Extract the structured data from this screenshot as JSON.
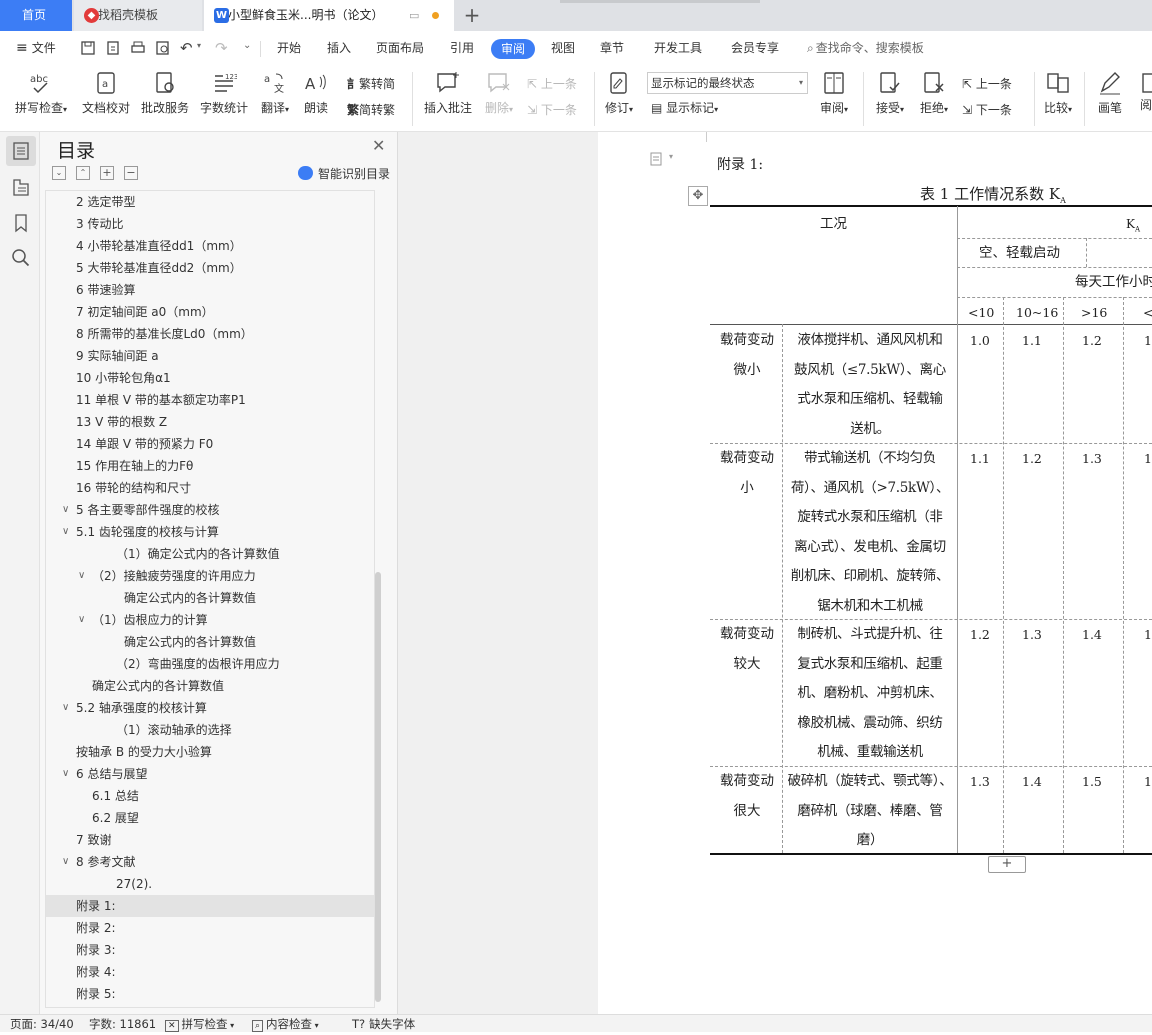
{
  "tabs": {
    "home": "首页",
    "templates": "找稻壳模板",
    "document": "小型鲜食玉米...明书（论文）",
    "add": "+"
  },
  "menu": {
    "file": "文件",
    "items": [
      "开始",
      "插入",
      "页面布局",
      "引用",
      "审阅",
      "视图",
      "章节",
      "开发工具",
      "会员专享"
    ],
    "active": "审阅",
    "search_placeholder": "查找命令、搜索模板"
  },
  "ribbon": {
    "spellcheck": "拼写检查",
    "doc_proof": "文档校对",
    "batch_service": "批改服务",
    "word_count": "字数统计",
    "translate": "翻译",
    "read_aloud": "朗读",
    "trad_to_simp": "繁转简",
    "simp_to_trad": "简转繁",
    "insert_comment": "插入批注",
    "delete": "删除",
    "prev_comment": "上一条",
    "next_comment": "下一条",
    "revise": "修订",
    "markup_state": "显示标记的最终状态",
    "show_markup": "显示标记",
    "review": "审阅",
    "accept": "接受",
    "reject": "拒绝",
    "prev_change": "上一条",
    "next_change": "下一条",
    "compare": "比较",
    "pen": "画笔",
    "more": "阅"
  },
  "toc": {
    "title": "目录",
    "smart_identify": "智能识别目录",
    "items": [
      {
        "text": "2 选定带型",
        "level": 2,
        "caret": ""
      },
      {
        "text": "3 传动比",
        "level": 2,
        "caret": ""
      },
      {
        "text": "4 小带轮基准直径dd1（mm）",
        "level": 2,
        "caret": ""
      },
      {
        "text": "5 大带轮基准直径dd2（mm）",
        "level": 2,
        "caret": ""
      },
      {
        "text": "6 带速验算",
        "level": 2,
        "caret": ""
      },
      {
        "text": "7 初定轴间距 a0（mm）",
        "level": 2,
        "caret": ""
      },
      {
        "text": "8 所需带的基准长度Ld0（mm）",
        "level": 2,
        "caret": ""
      },
      {
        "text": "9 实际轴间距 a",
        "level": 2,
        "caret": ""
      },
      {
        "text": "10 小带轮包角α1",
        "level": 2,
        "caret": ""
      },
      {
        "text": "11 单根 V 带的基本额定功率P1",
        "level": 2,
        "caret": ""
      },
      {
        "text": "13 V 带的根数 Z",
        "level": 2,
        "caret": ""
      },
      {
        "text": "14 单跟 V 带的预紧力 F0",
        "level": 2,
        "caret": ""
      },
      {
        "text": "15 作用在轴上的力Fθ",
        "level": 2,
        "caret": ""
      },
      {
        "text": "16 带轮的结构和尺寸",
        "level": 2,
        "caret": ""
      },
      {
        "text": "5 各主要零部件强度的校核",
        "level": 1,
        "caret": "v"
      },
      {
        "text": "5.1 齿轮强度的校核与计算",
        "level": 2,
        "caret": "v"
      },
      {
        "text": "（1）确定公式内的各计算数值",
        "level": 4,
        "caret": ""
      },
      {
        "text": "（2）接触疲劳强度的许用应力",
        "level": 3,
        "caret": "v"
      },
      {
        "text": "确定公式内的各计算数值",
        "level": 5,
        "caret": ""
      },
      {
        "text": "（1）齿根应力的计算",
        "level": 3,
        "caret": "v"
      },
      {
        "text": "确定公式内的各计算数值",
        "level": 5,
        "caret": ""
      },
      {
        "text": "（2）弯曲强度的齿根许用应力",
        "level": 4,
        "caret": ""
      },
      {
        "text": "确定公式内的各计算数值",
        "level": 3,
        "caret": ""
      },
      {
        "text": "5.2 轴承强度的校核计算",
        "level": 2,
        "caret": "v"
      },
      {
        "text": "（1）滚动轴承的选择",
        "level": 4,
        "caret": ""
      },
      {
        "text": "按轴承 B 的受力大小验算",
        "level": 1,
        "caret": ""
      },
      {
        "text": "6 总结与展望",
        "level": 1,
        "caret": "v"
      },
      {
        "text": "6.1 总结",
        "level": 3,
        "caret": ""
      },
      {
        "text": "6.2 展望",
        "level": 3,
        "caret": ""
      },
      {
        "text": "7 致谢",
        "level": 1,
        "caret": ""
      },
      {
        "text": "8 参考文献",
        "level": 1,
        "caret": "v"
      },
      {
        "text": "27(2).",
        "level": 4,
        "caret": ""
      },
      {
        "text": "附录 1:",
        "level": 1,
        "caret": "",
        "selected": true
      },
      {
        "text": "附录 2:",
        "level": 1,
        "caret": ""
      },
      {
        "text": "附录 3:",
        "level": 1,
        "caret": ""
      },
      {
        "text": "附录 4:",
        "level": 1,
        "caret": ""
      },
      {
        "text": "附录 5:",
        "level": 1,
        "caret": ""
      }
    ]
  },
  "document": {
    "appendix_heading": "附录 1:",
    "table_caption": "表 1 工作情况系数 K",
    "caption_sub": "A",
    "header": {
      "condition": "工况",
      "ka": "K",
      "ka_sub": "A",
      "start_type": "空、轻载启动",
      "hours": "每天工作小时",
      "col1": "<10",
      "col2": "10~16",
      "col3": ">16",
      "col4": "<"
    },
    "rows": [
      {
        "load": [
          "载荷变动",
          "微小"
        ],
        "machines": [
          "液体搅拌机、通风风机和",
          "鼓风机（≤7.5kW）、离心",
          "式水泵和压缩机、轻载输",
          "送机。"
        ],
        "values": [
          "1.0",
          "1.1",
          "1.2",
          "1"
        ]
      },
      {
        "load": [
          "载荷变动",
          "小"
        ],
        "machines": [
          "带式输送机（不均匀负",
          "荷）、通风机（>7.5kW）、",
          "旋转式水泵和压缩机（非",
          "离心式）、发电机、金属切",
          "削机床、印刷机、旋转筛、",
          "锯木机和木工机械"
        ],
        "values": [
          "1.1",
          "1.2",
          "1.3",
          "1"
        ]
      },
      {
        "load": [
          "载荷变动",
          "较大"
        ],
        "machines": [
          "制砖机、斗式提升机、往",
          "复式水泵和压缩机、起重",
          "机、磨粉机、冲剪机床、",
          "橡胶机械、震动筛、织纺",
          "机械、重载输送机"
        ],
        "values": [
          "1.2",
          "1.3",
          "1.4",
          "1"
        ]
      },
      {
        "load": [
          "载荷变动",
          "很大"
        ],
        "machines": [
          "破碎机（旋转式、颚式等）、",
          "磨碎机（球磨、棒磨、管",
          "磨）"
        ],
        "values": [
          "1.3",
          "1.4",
          "1.5",
          "1"
        ]
      }
    ],
    "add_row": "+"
  },
  "status": {
    "page": "页面: 34/40",
    "words": "字数: 11861",
    "spell": "拼写检查",
    "content_check": "内容检查",
    "missing_font": "缺失字体"
  }
}
